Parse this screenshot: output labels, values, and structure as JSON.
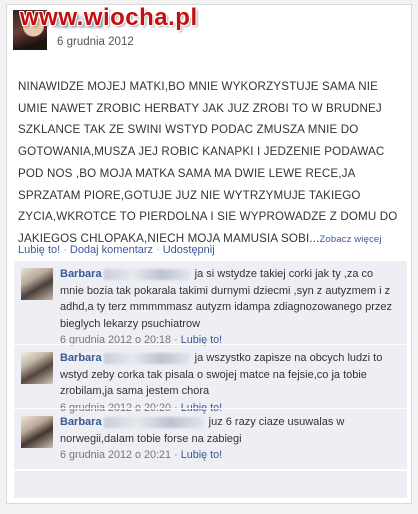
{
  "watermark": "www.wiocha.pl",
  "post": {
    "date": "6 grudnia 2012",
    "text": "NINAWIDZE MOJEJ MATKI,BO MNIE WYKORZYSTUJE SAMA NIE UMIE NAWET ZROBIC HERBATY JAK JUZ ZROBI TO W BRUDNEJ SZKLANCE TAK ZE SWINI WSTYD PODAC ZMUSZA MNIE DO GOTOWANIA,MUSZA JEJ ROBIC KANAPKI I JEDZENIE PODAWAC POD NOS ,BO MOJA MATKA SAMA MA DWIE LEWE RECE,JA SPRZATAM PIORE,GOTUJE JUZ NIE WYTRZYMUJE TAKIEGO ZYCIA,WKROTCE TO PIERDOLNA I SIE WYPROWADZE Z DOMU DO JAKIEGOS CHLOPAKA,NIECH MOJA MAMUSIA SOBI...",
    "see_more": "Zobacz więcej"
  },
  "actions": {
    "like": "Lubię to!",
    "comment": "Dodaj komentarz",
    "share": "Udostępnij",
    "separator": "·"
  },
  "comments": [
    {
      "name": "Barbara",
      "text": "ja si wstydze takiej corki jak ty ,za co mnie bozia tak pokarala takimi durnymi dziecmi ,syn z autyzmem i z adhd,a ty terz mmmmmasz autyzm idampa zdiagnozowanego przez bieglych lekarzy psuchiatrow",
      "date": "6 grudnia 2012 o 20:18",
      "like": "Lubię to!"
    },
    {
      "name": "Barbara",
      "text": "ja wszystko zapisze na obcych ludzi to wstyd zeby corka tak pisala o swojej matce na fejsie,co ja tobie zrobilam,ja sama jestem chora",
      "date": "6 grudnia 2012 o 20:20",
      "like": "Lubię to!"
    },
    {
      "name": "Barbara",
      "text": "juz 6 razy ciaze usuwalas w norwegii,dalam tobie forse na zabiegi",
      "date": "6 grudnia 2012 o 20:21",
      "like": "Lubię to!"
    }
  ]
}
